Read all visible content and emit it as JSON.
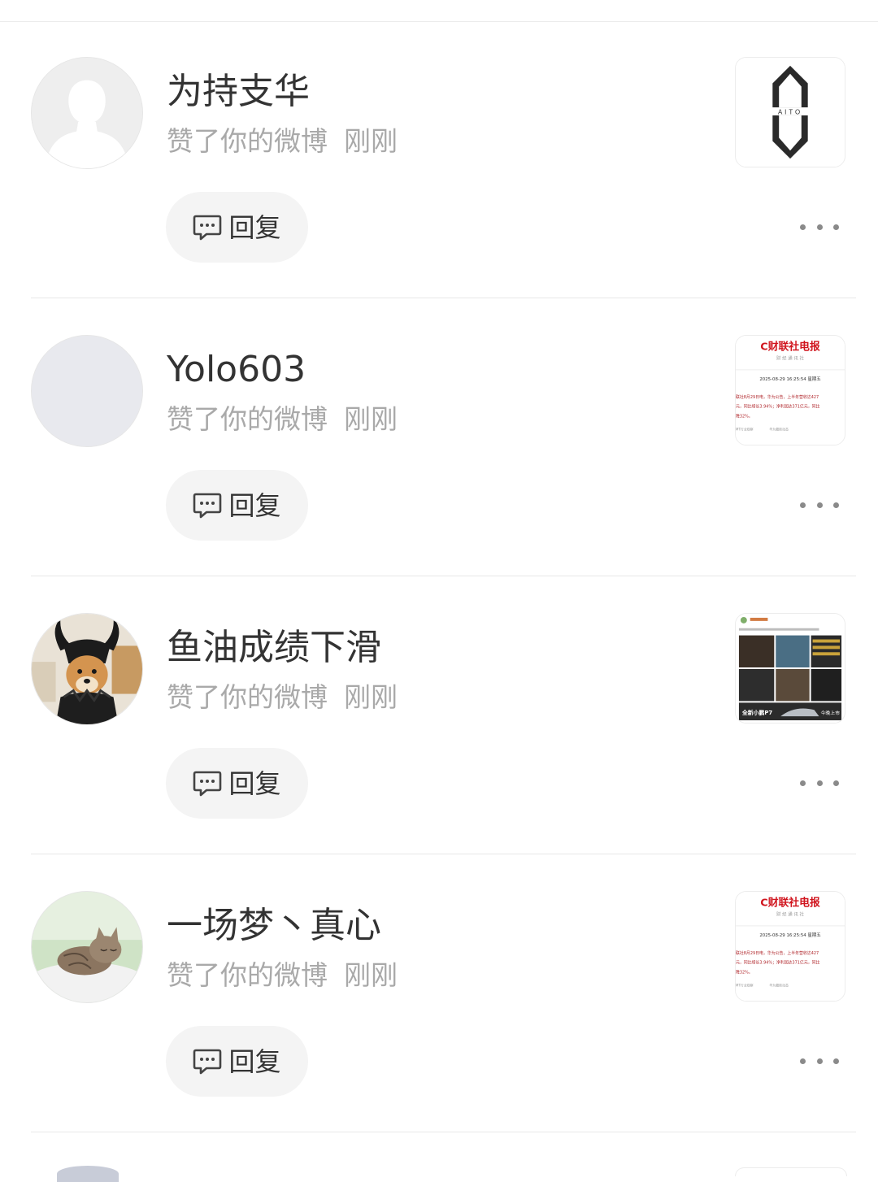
{
  "notifications": [
    {
      "username": "为持支华",
      "action": "赞了你的微博",
      "time": "刚刚",
      "reply_label": "回复",
      "avatar_icon": "default-avatar-icon",
      "thumbnail": {
        "kind": "logo",
        "text": "AITO"
      }
    },
    {
      "username": "Yolo603",
      "action": "赞了你的微博",
      "time": "刚刚",
      "reply_label": "回复",
      "avatar_icon": "blank-avatar-icon",
      "thumbnail": {
        "kind": "news",
        "brand": "C财联社电报",
        "sub": "财 经 通 讯 社",
        "date": "2025-08-29 16:25:54 星期五",
        "line1": "联社8月29日电，华为公告，上半年营收达427",
        "line2": "元，同比增长3.94%；净利润达371亿元，同比",
        "line3": "降32%。",
        "footer_left": "MT行业观察",
        "footer_right": "华为最新动态"
      }
    },
    {
      "username": "鱼油成绩下滑",
      "action": "赞了你的微博",
      "time": "刚刚",
      "reply_label": "回复",
      "avatar_icon": "dog-avatar-icon",
      "thumbnail": {
        "kind": "car-post",
        "caption_left": "全新小鹏P7",
        "caption_right": "今晚上市"
      }
    },
    {
      "username": "一场梦丶真心",
      "action": "赞了你的微博",
      "time": "刚刚",
      "reply_label": "回复",
      "avatar_icon": "cat-avatar-icon",
      "thumbnail": {
        "kind": "news",
        "brand": "C财联社电报",
        "sub": "财 经 通 讯 社",
        "date": "2025-08-29 16:25:54 星期五",
        "line1": "联社8月29日电，华为公告，上半年营收达427",
        "line2": "元，同比增长3.94%；净利润达371亿元，同比",
        "line3": "降32%。",
        "footer_left": "MT行业观察",
        "footer_right": "华为最新动态"
      }
    }
  ],
  "colors": {
    "name_text": "#333333",
    "meta_text": "#a9a9a9",
    "button_bg": "#f4f4f4",
    "divider": "#e8e8e8",
    "brand_red": "#d0141d"
  }
}
